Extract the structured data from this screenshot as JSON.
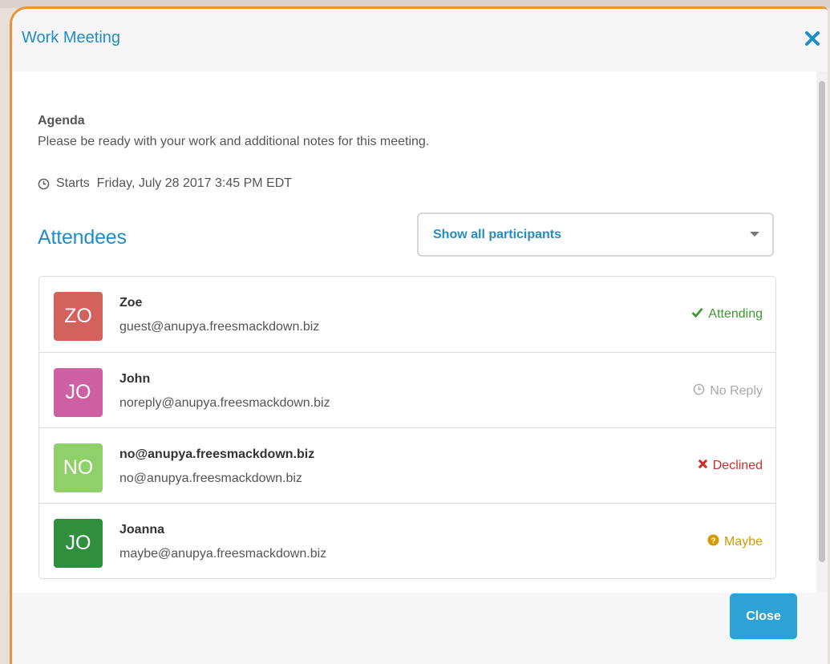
{
  "modal": {
    "title": "Work Meeting",
    "agenda_label": "Agenda",
    "agenda_text": "Please be ready with your work and additional notes for this meeting.",
    "starts_text": "Starts  Friday, July 28 2017 3:45 PM EDT",
    "attendees_heading": "Attendees",
    "filter": {
      "selected": "Show all participants"
    },
    "close_button": "Close"
  },
  "attendees": [
    {
      "initials": "ZO",
      "name": "Zoe",
      "email": "guest@anupya.freesmackdown.biz",
      "status": "Attending",
      "status_icon": "check-icon",
      "avatar_color": "#d4625c",
      "status_color": "#3c9a2f"
    },
    {
      "initials": "JO",
      "name": "John",
      "email": "noreply@anupya.freesmackdown.biz",
      "status": "No Reply",
      "status_icon": "clock-icon",
      "avatar_color": "#cd5fa2",
      "status_color": "#aaaaaa"
    },
    {
      "initials": "NO",
      "name": "no@anupya.freesmackdown.biz",
      "email": "no@anupya.freesmackdown.biz",
      "status": "Declined",
      "status_icon": "x-icon",
      "avatar_color": "#8fd06a",
      "status_color": "#c9302c"
    },
    {
      "initials": "JO",
      "name": "Joanna",
      "email": "maybe@anupya.freesmackdown.biz",
      "status": "Maybe",
      "status_icon": "question-circle-icon",
      "avatar_color": "#2f8f3c",
      "status_color": "#d49a00"
    }
  ],
  "colors": {
    "accent": "#1f8dc8",
    "button": "#2ea2d4",
    "frame": "#e8953a"
  }
}
